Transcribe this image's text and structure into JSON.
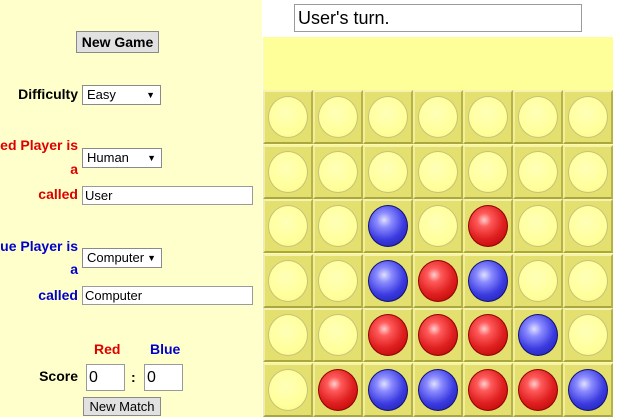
{
  "status_text": "User's turn.",
  "controls": {
    "new_game_label": "New Game",
    "difficulty_label": "Difficulty",
    "difficulty_value": "Easy",
    "new_match_label": "New Match"
  },
  "red_player": {
    "label_line1": "Red Player is",
    "label_line2": "a",
    "type_value": "Human",
    "called_label": "called",
    "name_value": "User"
  },
  "blue_player": {
    "label_line1": "Blue Player is",
    "label_line2": "a",
    "type_value": "Computer",
    "called_label": "called",
    "name_value": "Computer"
  },
  "score": {
    "label": "Score",
    "red_header": "Red",
    "blue_header": "Blue",
    "separator": ":",
    "red_value": "0",
    "blue_value": "0"
  },
  "board": {
    "columns": 7,
    "rows": 6,
    "grid": [
      [
        "empty",
        "empty",
        "empty",
        "empty",
        "empty",
        "empty",
        "empty"
      ],
      [
        "empty",
        "empty",
        "empty",
        "empty",
        "empty",
        "empty",
        "empty"
      ],
      [
        "empty",
        "empty",
        "blue",
        "empty",
        "red",
        "empty",
        "empty"
      ],
      [
        "empty",
        "empty",
        "blue",
        "red",
        "blue",
        "empty",
        "empty"
      ],
      [
        "empty",
        "empty",
        "red",
        "red",
        "red",
        "blue",
        "empty"
      ],
      [
        "empty",
        "red",
        "blue",
        "blue",
        "red",
        "red",
        "blue"
      ]
    ]
  },
  "colors": {
    "red_text": "#dd0000",
    "blue_text": "#0000cc",
    "panel_bg": "#ffffcc",
    "board_bg": "#ffff99"
  }
}
